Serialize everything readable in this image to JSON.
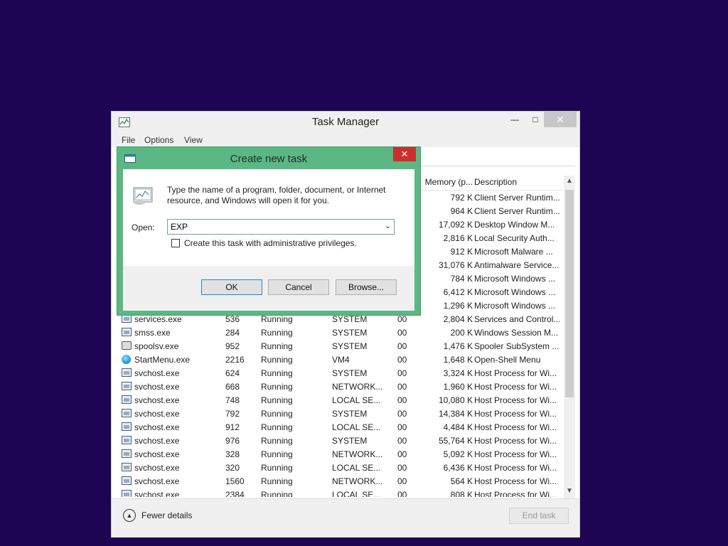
{
  "task_manager": {
    "title": "Task Manager",
    "menu": [
      "File",
      "Options",
      "View"
    ],
    "columns": {
      "memory": "Memory (p...",
      "description": "Description"
    },
    "rows_above_dialog": [
      {
        "memory": "792 K",
        "description": "Client Server Runtim..."
      },
      {
        "memory": "964 K",
        "description": "Client Server Runtim..."
      },
      {
        "memory": "17,092 K",
        "description": "Desktop Window M..."
      },
      {
        "memory": "2,816 K",
        "description": "Local Security Auth..."
      },
      {
        "memory": "912 K",
        "description": "Microsoft Malware ..."
      },
      {
        "memory": "31,076 K",
        "description": "Antimalware Service..."
      },
      {
        "memory": "784 K",
        "description": "Microsoft Windows ..."
      },
      {
        "memory": "6,412 K",
        "description": "Microsoft Windows ..."
      },
      {
        "memory": "1,296 K",
        "description": "Microsoft Windows ..."
      }
    ],
    "rows": [
      {
        "icon": "exe",
        "name": "services.exe",
        "pid": "536",
        "status": "Running",
        "user": "SYSTEM",
        "cpu": "00",
        "memory": "2,804 K",
        "description": "Services and Control..."
      },
      {
        "icon": "exe",
        "name": "smss.exe",
        "pid": "284",
        "status": "Running",
        "user": "SYSTEM",
        "cpu": "00",
        "memory": "200 K",
        "description": "Windows Session M..."
      },
      {
        "icon": "printer",
        "name": "spoolsv.exe",
        "pid": "952",
        "status": "Running",
        "user": "SYSTEM",
        "cpu": "00",
        "memory": "1,476 K",
        "description": "Spooler SubSystem ..."
      },
      {
        "icon": "globe",
        "name": "StartMenu.exe",
        "pid": "2216",
        "status": "Running",
        "user": "VM4",
        "cpu": "00",
        "memory": "1,648 K",
        "description": "Open-Shell Menu"
      },
      {
        "icon": "exe",
        "name": "svchost.exe",
        "pid": "624",
        "status": "Running",
        "user": "SYSTEM",
        "cpu": "00",
        "memory": "3,324 K",
        "description": "Host Process for Wi..."
      },
      {
        "icon": "exe",
        "name": "svchost.exe",
        "pid": "668",
        "status": "Running",
        "user": "NETWORK...",
        "cpu": "00",
        "memory": "1,960 K",
        "description": "Host Process for Wi..."
      },
      {
        "icon": "exe",
        "name": "svchost.exe",
        "pid": "748",
        "status": "Running",
        "user": "LOCAL SE...",
        "cpu": "00",
        "memory": "10,080 K",
        "description": "Host Process for Wi..."
      },
      {
        "icon": "exe",
        "name": "svchost.exe",
        "pid": "792",
        "status": "Running",
        "user": "SYSTEM",
        "cpu": "00",
        "memory": "14,384 K",
        "description": "Host Process for Wi..."
      },
      {
        "icon": "exe",
        "name": "svchost.exe",
        "pid": "912",
        "status": "Running",
        "user": "LOCAL SE...",
        "cpu": "00",
        "memory": "4,484 K",
        "description": "Host Process for Wi..."
      },
      {
        "icon": "exe",
        "name": "svchost.exe",
        "pid": "976",
        "status": "Running",
        "user": "SYSTEM",
        "cpu": "00",
        "memory": "55,764 K",
        "description": "Host Process for Wi..."
      },
      {
        "icon": "exe",
        "name": "svchost.exe",
        "pid": "328",
        "status": "Running",
        "user": "NETWORK...",
        "cpu": "00",
        "memory": "5,092 K",
        "description": "Host Process for Wi..."
      },
      {
        "icon": "exe",
        "name": "svchost.exe",
        "pid": "320",
        "status": "Running",
        "user": "LOCAL SE...",
        "cpu": "00",
        "memory": "6,436 K",
        "description": "Host Process for Wi..."
      },
      {
        "icon": "exe",
        "name": "svchost.exe",
        "pid": "1560",
        "status": "Running",
        "user": "NETWORK...",
        "cpu": "00",
        "memory": "564 K",
        "description": "Host Process for Wi..."
      },
      {
        "icon": "exe",
        "name": "svchost.exe",
        "pid": "2384",
        "status": "Running",
        "user": "LOCAL SE...",
        "cpu": "00",
        "memory": "808 K",
        "description": "Host Process for Wi..."
      }
    ],
    "fewer_details": "Fewer details",
    "end_task": "End task"
  },
  "run_dialog": {
    "title": "Create new task",
    "message": "Type the name of a program, folder, document, or Internet resource, and Windows will open it for you.",
    "open_label": "Open:",
    "open_value": "EXP",
    "admin_checkbox_label": "Create this task with administrative privileges.",
    "admin_checked": false,
    "ok": "OK",
    "cancel": "Cancel",
    "browse": "Browse...",
    "close_glyph": "✕"
  }
}
